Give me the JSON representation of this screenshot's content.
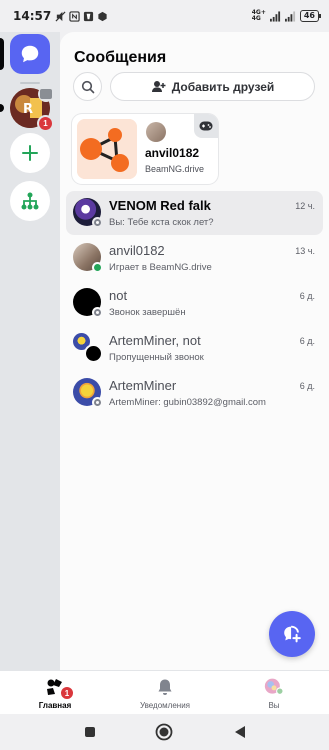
{
  "status_bar": {
    "time": "14:57",
    "network_top": "4G+",
    "network_bottom": "4G",
    "battery": "46"
  },
  "rail": {
    "dm_icon": "chat-bubble-icon",
    "server_badge": "1",
    "add_icon": "plus-icon",
    "discover_icon": "hub-icon",
    "accent": "#5865f2"
  },
  "header": {
    "title": "Сообщения",
    "add_friends_label": "Добавить друзей"
  },
  "activity_card": {
    "username": "anvil0182",
    "game": "BeamNG.drive"
  },
  "dms": [
    {
      "name": "VENOM Red falk",
      "subtitle": "Вы: Тебе кста скок лет?",
      "time": "12 ч.",
      "status": "offline",
      "selected": true
    },
    {
      "name": "anvil0182",
      "subtitle": "Играет в BeamNG.drive",
      "time": "13 ч.",
      "status": "online"
    },
    {
      "name": "not",
      "subtitle": "Звонок завершён",
      "time": "6 д.",
      "status": "offline"
    },
    {
      "name": "ArtemMiner, not",
      "subtitle": "Пропущенный звонок",
      "time": "6 д.",
      "status": "none"
    },
    {
      "name": "ArtemMiner",
      "subtitle": "ArtemMiner: gubin03892@gmail.com",
      "time": "6 д.",
      "status": "offline"
    }
  ],
  "tabs": [
    {
      "label": "Главная",
      "badge": "1",
      "active": true
    },
    {
      "label": "Уведомления"
    },
    {
      "label": "Вы"
    }
  ]
}
